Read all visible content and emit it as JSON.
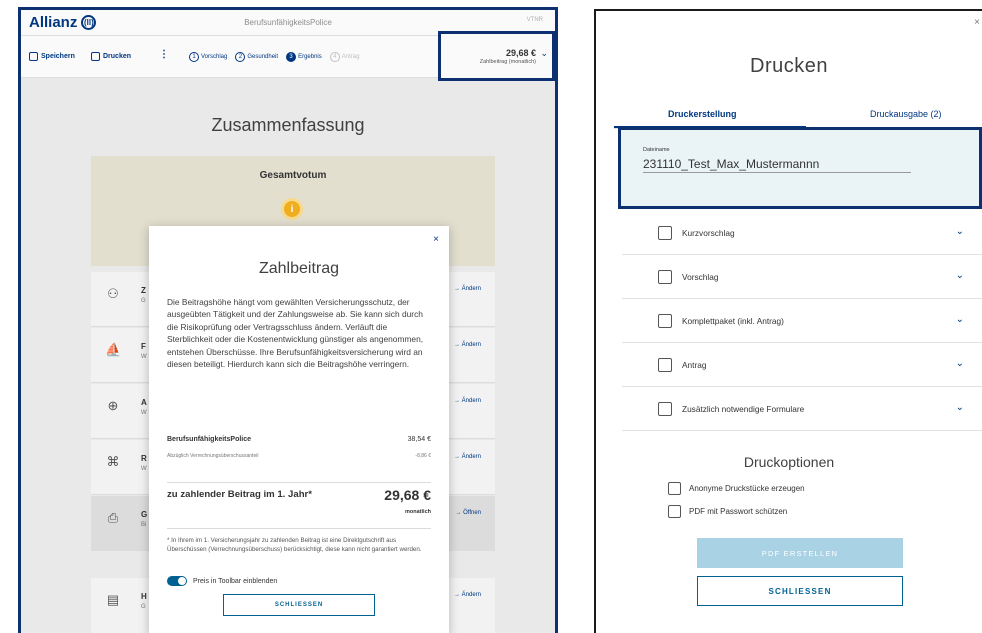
{
  "left": {
    "brand": "Allianz",
    "brand_mark": "(ll)",
    "app_title": "BerufsunfähigkeitsPolice",
    "vtnr": "VTNR",
    "toolbar": {
      "save_label": "Speichern",
      "print_label": "Drucken",
      "menu_glyph": "⋮",
      "steps": [
        {
          "num": "1",
          "label": "Vorschlag"
        },
        {
          "num": "2",
          "label": "Gesundheit"
        },
        {
          "num": "3",
          "label": "Ergebnis"
        },
        {
          "num": "4",
          "label": "Antrag"
        }
      ],
      "price_amount": "29,68 €",
      "price_label": "Zahlbeitrag (monatlich)"
    },
    "page_title": "Zusammenfassung",
    "votum_title": "Gesamtvotum",
    "votum_icon": "i",
    "rows": [
      {
        "icon": "person-icon",
        "letter": "Z",
        "sub": "G",
        "action": "→ Ändern"
      },
      {
        "icon": "sailboat-icon",
        "letter": "F",
        "sub": "W",
        "action": "→ Ändern"
      },
      {
        "icon": "globe-icon",
        "letter": "A",
        "sub": "W",
        "action": "→ Ändern"
      },
      {
        "icon": "puzzle-icon",
        "letter": "R",
        "sub": "W",
        "action": "→ Ändern"
      },
      {
        "icon": "printer-icon",
        "letter": "G",
        "sub": "Bi",
        "action": "→ Öffnen"
      },
      {
        "icon": "document-icon",
        "letter": "H",
        "sub": "G",
        "action": "→ Ändern"
      }
    ]
  },
  "modal": {
    "close": "×",
    "title": "Zahlbeitrag",
    "text": "Die Beitragshöhe hängt vom gewählten Versicherungsschutz, der ausgeübten Tätigkeit und der Zahlungsweise ab. Sie kann sich durch die Risikoprüfung oder Vertragsschluss ändern. Verläuft die Sterblichkeit oder die Kostenentwicklung günstiger als angenommen, entstehen Überschüsse. Ihre Berufsunfähigkeitsversicherung wird an diesen beteiligt. Hierdurch kann sich die Beitragshöhe verringern.",
    "item1_label": "BerufsunfähigkeitsPolice",
    "item1_value": "38,54 €",
    "item2_label": "Abzüglich Verrechnungsüberschussanteil",
    "item2_value": "-8,86 €",
    "total_label": "zu zahlender Beitrag im 1. Jahr*",
    "total_value": "29,68 €",
    "total_unit": "monatlich",
    "footnote": "* In Ihrem im 1. Versicherungsjahr zu zahlenden Beitrag ist eine Direktgutschrift aus Überschüssen (Verrechnungsüberschuss) berücksichtigt, diese kann nicht garantiert werden.",
    "toggle_label": "Preis in Toolbar einblenden",
    "button": "SCHLIESSEN"
  },
  "right": {
    "close": "×",
    "title": "Drucken",
    "tabs": [
      "Druckerstellung",
      "Druckausgabe (2)"
    ],
    "field_label": "Dateiname",
    "field_value": "231110_Test_Max_Mustermannn",
    "rows": [
      "Kurzvorschlag",
      "Vorschlag",
      "Komplettpaket (inkl. Antrag)",
      "Antrag",
      "Zusätzlich notwendige Formulare"
    ],
    "options_title": "Druckoptionen",
    "options": [
      "Anonyme Druckstücke erzeugen",
      "PDF mit Passwort schützen"
    ],
    "pdf_button": "PDF ERSTELLEN",
    "close_button": "SCHLIESSEN"
  },
  "colors": {
    "brand": "#003781",
    "highlight_border": "#0c3070",
    "toggle_on": "#006192",
    "disabled_button": "#a9d3e5",
    "votum_icon": "#f0ad1f"
  }
}
